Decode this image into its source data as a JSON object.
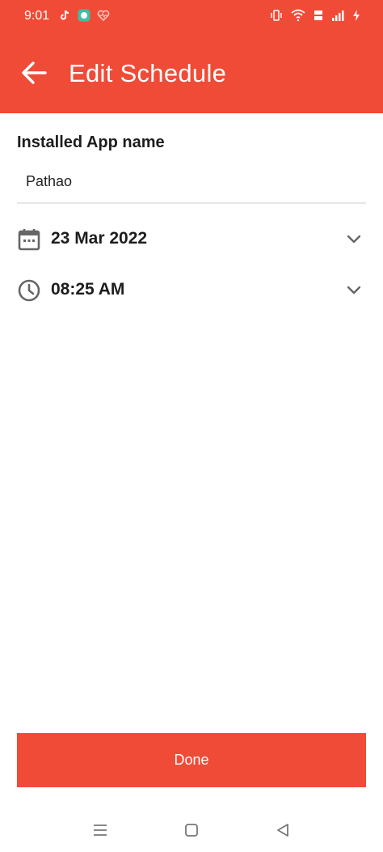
{
  "status_bar": {
    "time": "9:01",
    "left_icons": [
      "tiktok-icon",
      "chat-app-icon",
      "heart-pulse-icon"
    ],
    "right_icons": [
      "vibrate-icon",
      "wifi-icon",
      "volte-icon",
      "signal-icon",
      "charging-icon"
    ]
  },
  "app_bar": {
    "title": "Edit Schedule",
    "back_icon": "arrow-left-icon"
  },
  "form": {
    "app_name_label": "Installed App name",
    "app_name_value": "Pathao",
    "date_value": "23 Mar 2022",
    "time_value": "08:25 AM"
  },
  "actions": {
    "done_label": "Done"
  },
  "colors": {
    "accent": "#f04b37",
    "text": "#1d1d1d",
    "icon_gray": "#666666"
  }
}
